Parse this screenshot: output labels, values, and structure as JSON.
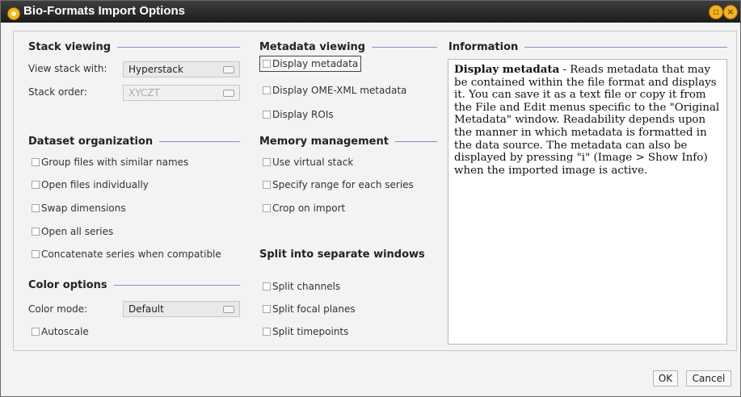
{
  "window": {
    "title": "Bio-Formats Import Options"
  },
  "stack_viewing": {
    "heading": "Stack viewing",
    "view_stack_label": "View stack with:",
    "view_stack_value": "Hyperstack",
    "stack_order_label": "Stack order:",
    "stack_order_value": "XYCZT"
  },
  "dataset_organization": {
    "heading": "Dataset organization",
    "group_files": "Group files with similar names",
    "open_individually": "Open files individually",
    "swap_dimensions": "Swap dimensions",
    "open_all_series": "Open all series",
    "concatenate": "Concatenate series when compatible"
  },
  "color_options": {
    "heading": "Color options",
    "color_mode_label": "Color mode:",
    "color_mode_value": "Default",
    "autoscale": "Autoscale"
  },
  "metadata_viewing": {
    "heading": "Metadata viewing",
    "display_metadata": "Display metadata",
    "display_ome_xml": "Display OME-XML metadata",
    "display_rois": "Display ROIs"
  },
  "memory_management": {
    "heading": "Memory management",
    "virtual_stack": "Use virtual stack",
    "specify_range": "Specify range for each series",
    "crop_on_import": "Crop on import"
  },
  "split_windows": {
    "heading": "Split into separate windows",
    "split_channels": "Split channels",
    "split_focal_planes": "Split focal planes",
    "split_timepoints": "Split timepoints"
  },
  "information": {
    "heading": "Information",
    "title": "Display metadata",
    "body": " - Reads metadata that may be contained within the file format and displays it. You can save it as a text file or copy it from the File and Edit menus specific to the \"Original Metadata\" window. Readability depends upon the manner in which metadata is formatted in the data source. The metadata can also be displayed by pressing \"i\" (Image > Show Info) when the imported image is active."
  },
  "buttons": {
    "ok": "OK",
    "cancel": "Cancel"
  }
}
